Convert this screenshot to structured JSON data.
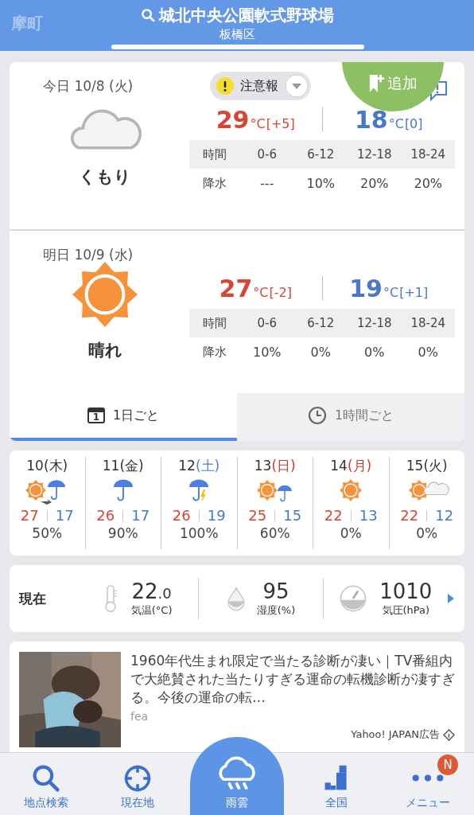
{
  "header": {
    "previous_location": "摩町",
    "location": "城北中央公園軟式野球場",
    "area": "板橋区"
  },
  "add_button": {
    "label": "追加"
  },
  "days": [
    {
      "date": "今日 10/8 (火)",
      "warning": {
        "label": "注意報"
      },
      "weather": "くもり",
      "kind": "cloudy",
      "high": "29",
      "high_unit": "°C",
      "high_diff": "[+5]",
      "low": "18",
      "low_unit": "°C",
      "low_diff": "[0]",
      "time_label": "時間",
      "times": [
        "0-6",
        "6-12",
        "12-18",
        "18-24"
      ],
      "precip_label": "降水",
      "precip": [
        "---",
        "10%",
        "20%",
        "20%"
      ]
    },
    {
      "date": "明日 10/9 (水)",
      "weather": "晴れ",
      "kind": "sunny",
      "high": "27",
      "high_unit": "°C",
      "high_diff": "[-2]",
      "low": "19",
      "low_unit": "°C",
      "low_diff": "[+1]",
      "time_label": "時間",
      "times": [
        "0-6",
        "6-12",
        "12-18",
        "18-24"
      ],
      "precip_label": "降水",
      "precip": [
        "10%",
        "0%",
        "0%",
        "0%"
      ]
    }
  ],
  "tabs": [
    {
      "label": "1日ごと",
      "selected": true,
      "icon_text": "1"
    },
    {
      "label": "1時間ごと",
      "selected": false
    }
  ],
  "week": [
    {
      "day": "10",
      "weekday": "(木)",
      "color": "#333333",
      "kind": "sun_then_rain",
      "high": "27",
      "low": "17",
      "precip": "50%"
    },
    {
      "day": "11",
      "weekday": "(金)",
      "color": "#333333",
      "kind": "rain",
      "high": "26",
      "low": "17",
      "precip": "90%"
    },
    {
      "day": "12",
      "weekday": "(土)",
      "color": "#4f7fd0",
      "kind": "thunder_rain",
      "high": "26",
      "low": "19",
      "precip": "100%"
    },
    {
      "day": "13",
      "weekday": "(日)",
      "color": "#c8402f",
      "kind": "sun_rain",
      "high": "25",
      "low": "15",
      "precip": "60%"
    },
    {
      "day": "14",
      "weekday": "(月)",
      "color": "#c8402f",
      "kind": "sun",
      "high": "22",
      "low": "13",
      "precip": "0%"
    },
    {
      "day": "15",
      "weekday": "(火)",
      "color": "#333333",
      "kind": "sun_cloud",
      "high": "22",
      "low": "12",
      "precip": "0%"
    }
  ],
  "current": {
    "label": "現在",
    "items": [
      {
        "kind": "temperature",
        "value": "22",
        "decimal": ".0",
        "label": "気温(°C)"
      },
      {
        "kind": "humidity",
        "value": "95",
        "label": "湿度(%)"
      },
      {
        "kind": "pressure",
        "value": "1010",
        "label": "気圧(hPa)"
      }
    ]
  },
  "ad": {
    "title": "1960年代生まれ限定で当たる診断が凄い｜TV番組内で大絶賛された当たりすぎる運命の転機診断が凄すぎる。今後の運命の転…",
    "source": "fea",
    "sponsor": "Yahoo! JAPAN広告"
  },
  "nav": [
    {
      "kind": "search",
      "label": "地点検索"
    },
    {
      "kind": "location",
      "label": "現在地"
    },
    {
      "kind": "radar",
      "label": "雨雲"
    },
    {
      "kind": "map",
      "label": "全国"
    },
    {
      "kind": "menu",
      "label": "メニュー",
      "badge": "N"
    }
  ]
}
